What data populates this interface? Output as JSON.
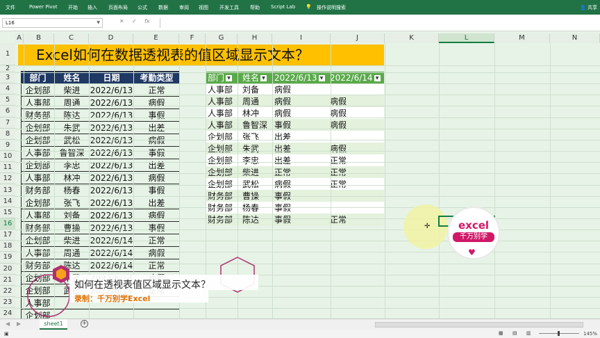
{
  "ribbon": {
    "tabs": [
      "文件",
      "Power Pivot",
      "开始",
      "插入",
      "页面布局",
      "公式",
      "数据",
      "审阅",
      "视图",
      "开发工具",
      "帮助",
      "Script Lab"
    ],
    "tellme": "操作说明搜索",
    "share": "共享"
  },
  "formula_bar": {
    "name_box": "L16",
    "fx": "fx",
    "content": ""
  },
  "columns": [
    "A",
    "B",
    "C",
    "D",
    "E",
    "F",
    "G",
    "H",
    "I",
    "J",
    "K",
    "L",
    "M",
    "N"
  ],
  "rows": [
    "1",
    "2",
    "3",
    "4",
    "5",
    "6",
    "7",
    "8",
    "9",
    "10",
    "11",
    "12",
    "13",
    "14",
    "15",
    "16",
    "17",
    "18",
    "19",
    "20",
    "21",
    "22",
    "23",
    "24"
  ],
  "title": "Excel如何在数据透视表的值区域显示文本？",
  "source_table": {
    "headers": [
      "部门",
      "姓名",
      "日期",
      "考勤类型"
    ],
    "rows": [
      [
        "企划部",
        "柴进",
        "2022/6/13",
        "正常"
      ],
      [
        "人事部",
        "周通",
        "2022/6/13",
        "病假"
      ],
      [
        "财务部",
        "陈达",
        "2022/6/13",
        "事假"
      ],
      [
        "企划部",
        "朱武",
        "2022/6/13",
        "出差"
      ],
      [
        "企划部",
        "武松",
        "2022/6/13",
        "病假"
      ],
      [
        "人事部",
        "鲁智深",
        "2022/6/13",
        "事假"
      ],
      [
        "企划部",
        "李忠",
        "2022/6/13",
        "出差"
      ],
      [
        "人事部",
        "林冲",
        "2022/6/13",
        "病假"
      ],
      [
        "财务部",
        "杨春",
        "2022/6/13",
        "事假"
      ],
      [
        "企划部",
        "张飞",
        "2022/6/13",
        "出差"
      ],
      [
        "人事部",
        "刘备",
        "2022/6/13",
        "病假"
      ],
      [
        "财务部",
        "曹操",
        "2022/6/13",
        "事假"
      ],
      [
        "企划部",
        "柴进",
        "2022/6/14",
        "正常"
      ],
      [
        "人事部",
        "周通",
        "2022/6/14",
        "病假"
      ],
      [
        "财务部",
        "陈达",
        "2022/6/14",
        "正常"
      ],
      [
        "企划部",
        "朱武",
        "2022/6/14",
        "病假"
      ],
      [
        "企划部",
        "武松",
        "2022/6/14",
        "正常"
      ],
      [
        "人事部",
        "",
        "",
        ""
      ],
      [
        "企划部",
        "",
        "",
        ""
      ],
      [
        "人事部",
        "",
        "",
        ""
      ]
    ]
  },
  "pivot_table": {
    "headers": [
      "部门",
      "姓名",
      "2022/6/13",
      "2022/6/14"
    ],
    "rows": [
      [
        "人事部",
        "刘备",
        "病假",
        ""
      ],
      [
        "人事部",
        "周通",
        "病假",
        "病假"
      ],
      [
        "人事部",
        "林冲",
        "病假",
        "病假"
      ],
      [
        "人事部",
        "鲁智深",
        "事假",
        "病假"
      ],
      [
        "企划部",
        "张飞",
        "出差",
        ""
      ],
      [
        "企划部",
        "朱武",
        "出差",
        "病假"
      ],
      [
        "企划部",
        "李忠",
        "出差",
        "正常"
      ],
      [
        "企划部",
        "柴进",
        "正常",
        "正常"
      ],
      [
        "企划部",
        "武松",
        "病假",
        "正常"
      ],
      [
        "财务部",
        "曹操",
        "事假",
        ""
      ],
      [
        "财务部",
        "杨春",
        "事假",
        ""
      ],
      [
        "财务部",
        "陈达",
        "事假",
        "正常"
      ]
    ]
  },
  "sheet_tab": "sheet1",
  "zoom": "145%",
  "caption": {
    "line1": "如何在透视表值区域显示文本？",
    "line2": "录制：千万别学Excel"
  },
  "logo": {
    "line1": "excel",
    "line2": "千万别学"
  },
  "colors": {
    "ribbon": "#217346",
    "title_bg": "#ffc000",
    "src_header": "#1f3864",
    "pivot_header": "#5aa94a",
    "grid_bg": "#e6f3e6"
  }
}
